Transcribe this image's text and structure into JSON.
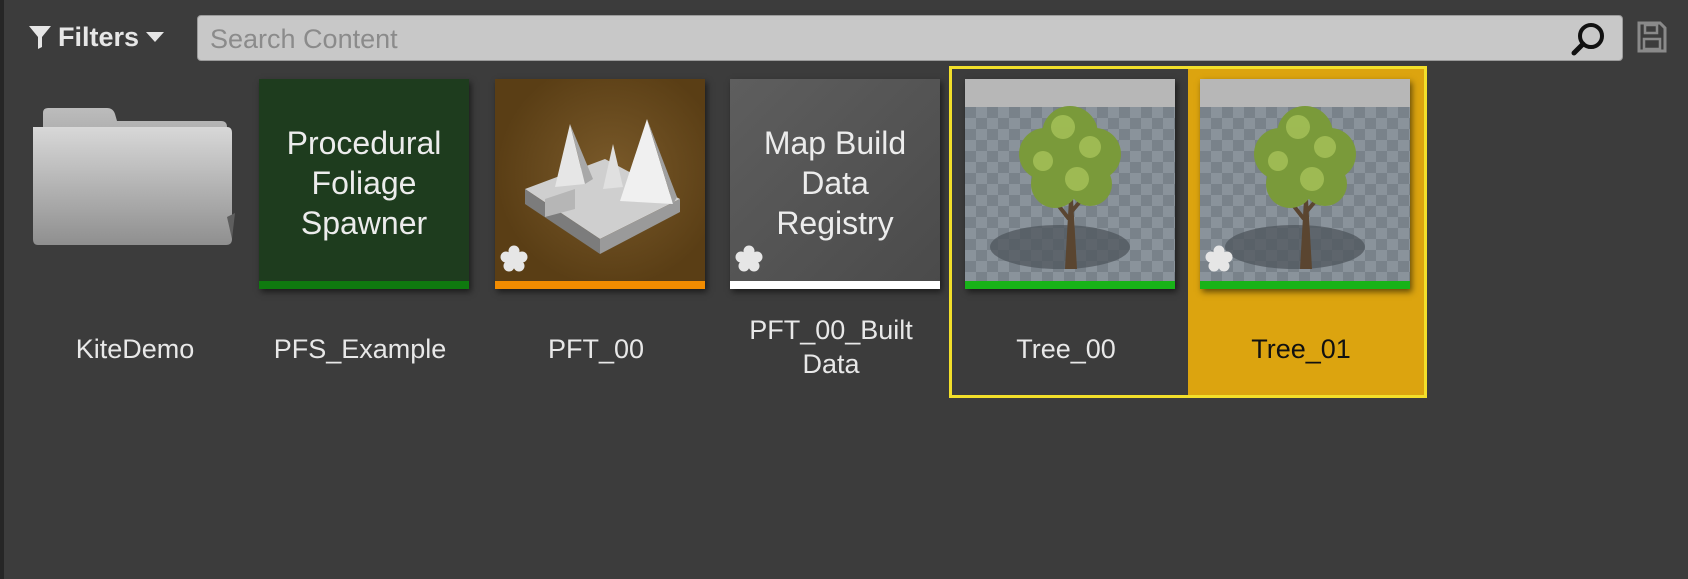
{
  "toolbar": {
    "filters_label": "Filters",
    "search_placeholder": "Search Content",
    "search_value": ""
  },
  "icons": {
    "filter": "funnel-icon",
    "dropdown": "caret-down-icon",
    "search": "magnifier-icon",
    "save": "floppy-disk-icon",
    "folder": "folder-icon",
    "new_asset": "asterisk-icon"
  },
  "colors": {
    "background": "#3c3c3c",
    "selection_border": "#f2df2a",
    "selected_fill": "#dca40f",
    "pfs_bar": "#0f7a0f",
    "pft_bar": "#f28c00",
    "registry_bar": "#ffffff",
    "tree_bar": "#18b318"
  },
  "items": [
    {
      "name": "KiteDemo",
      "type": "folder",
      "selected": false
    },
    {
      "name": "PFS_Example",
      "type": "asset",
      "thumb_text": [
        "Procedural",
        "Foliage",
        "Spawner"
      ],
      "bar_color": "#0f7a0f",
      "selected": false
    },
    {
      "name": "PFT_00",
      "type": "asset",
      "bar_color": "#f28c00",
      "modified": true,
      "selected": false
    },
    {
      "name_lines": [
        "PFT_00_Built",
        "Data"
      ],
      "type": "asset",
      "thumb_text": [
        "Map Build",
        "Data",
        "Registry"
      ],
      "bar_color": "#ffffff",
      "modified": true,
      "selected": false
    },
    {
      "name": "Tree_00",
      "type": "asset",
      "bar_color": "#18b318",
      "selected": true
    },
    {
      "name": "Tree_01",
      "type": "asset",
      "bar_color": "#18b318",
      "modified": true,
      "selected": true,
      "focused": true
    }
  ]
}
